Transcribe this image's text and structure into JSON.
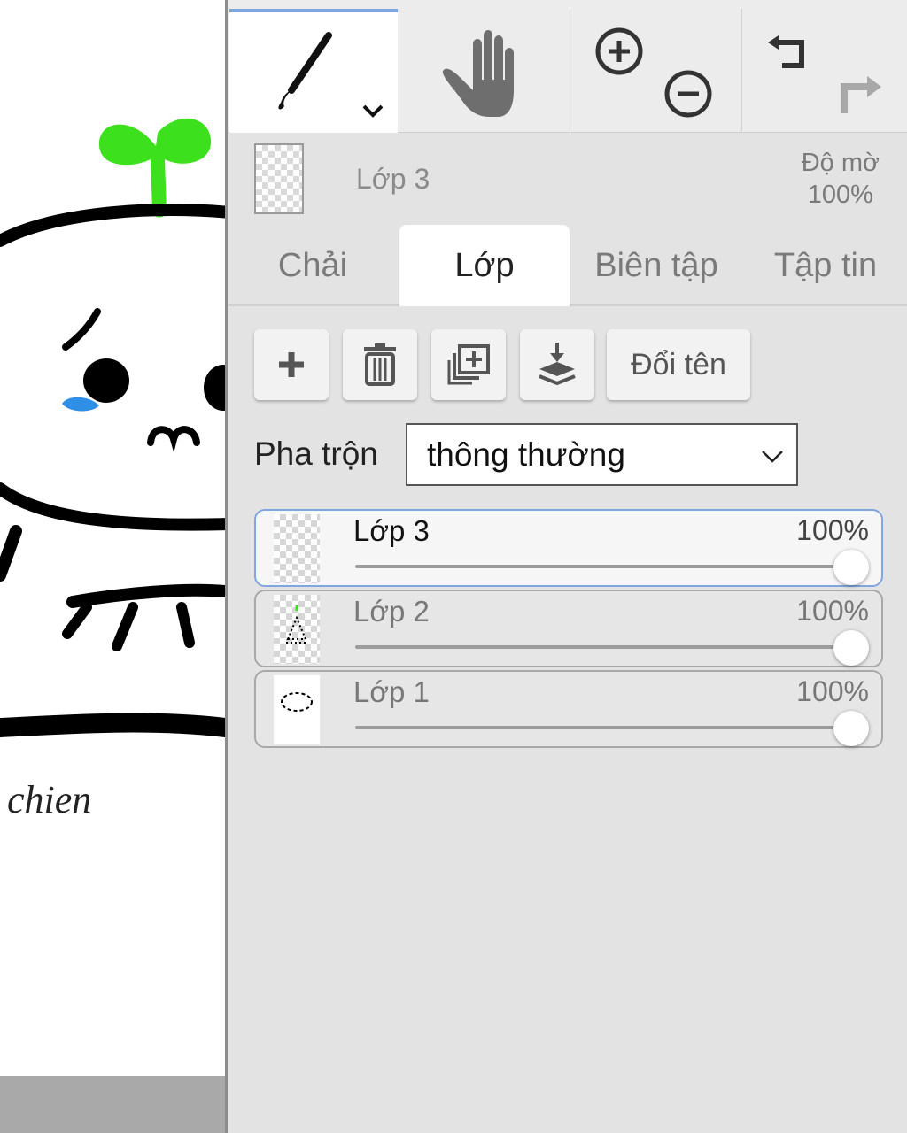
{
  "canvas": {
    "signature_text": "chien"
  },
  "toolbar": {
    "tools": [
      {
        "name": "brush",
        "icon": "brush-icon",
        "selected": true
      },
      {
        "name": "hand",
        "icon": "hand-icon"
      },
      {
        "name": "zoom-in",
        "icon": "zoom-in-icon"
      },
      {
        "name": "zoom-out",
        "icon": "zoom-out-icon"
      },
      {
        "name": "undo",
        "icon": "undo-icon"
      },
      {
        "name": "redo",
        "icon": "redo-icon",
        "disabled": true
      }
    ],
    "accent_color": "#7fa6e0"
  },
  "current_layer": {
    "name": "Lớp 3",
    "opacity_label": "Độ mờ",
    "opacity_value": "100%"
  },
  "tabs": [
    {
      "label": "Chải",
      "active": false
    },
    {
      "label": "Lớp",
      "active": true
    },
    {
      "label": "Biên tập",
      "active": false
    },
    {
      "label": "Tập tin",
      "active": false
    }
  ],
  "actions": {
    "add_icon": "plus-icon",
    "delete_icon": "trash-icon",
    "duplicate_icon": "duplicate-icon",
    "merge_icon": "merge-down-icon",
    "rename_label": "Đổi tên"
  },
  "blend": {
    "label": "Pha trộn",
    "value": "thông thường"
  },
  "layers": [
    {
      "name": "Lớp 3",
      "opacity": "100%",
      "opacity_fraction": 1.0,
      "selected": true
    },
    {
      "name": "Lớp 2",
      "opacity": "100%",
      "opacity_fraction": 1.0,
      "selected": false
    },
    {
      "name": "Lớp 1",
      "opacity": "100%",
      "opacity_fraction": 1.0,
      "selected": false
    }
  ]
}
